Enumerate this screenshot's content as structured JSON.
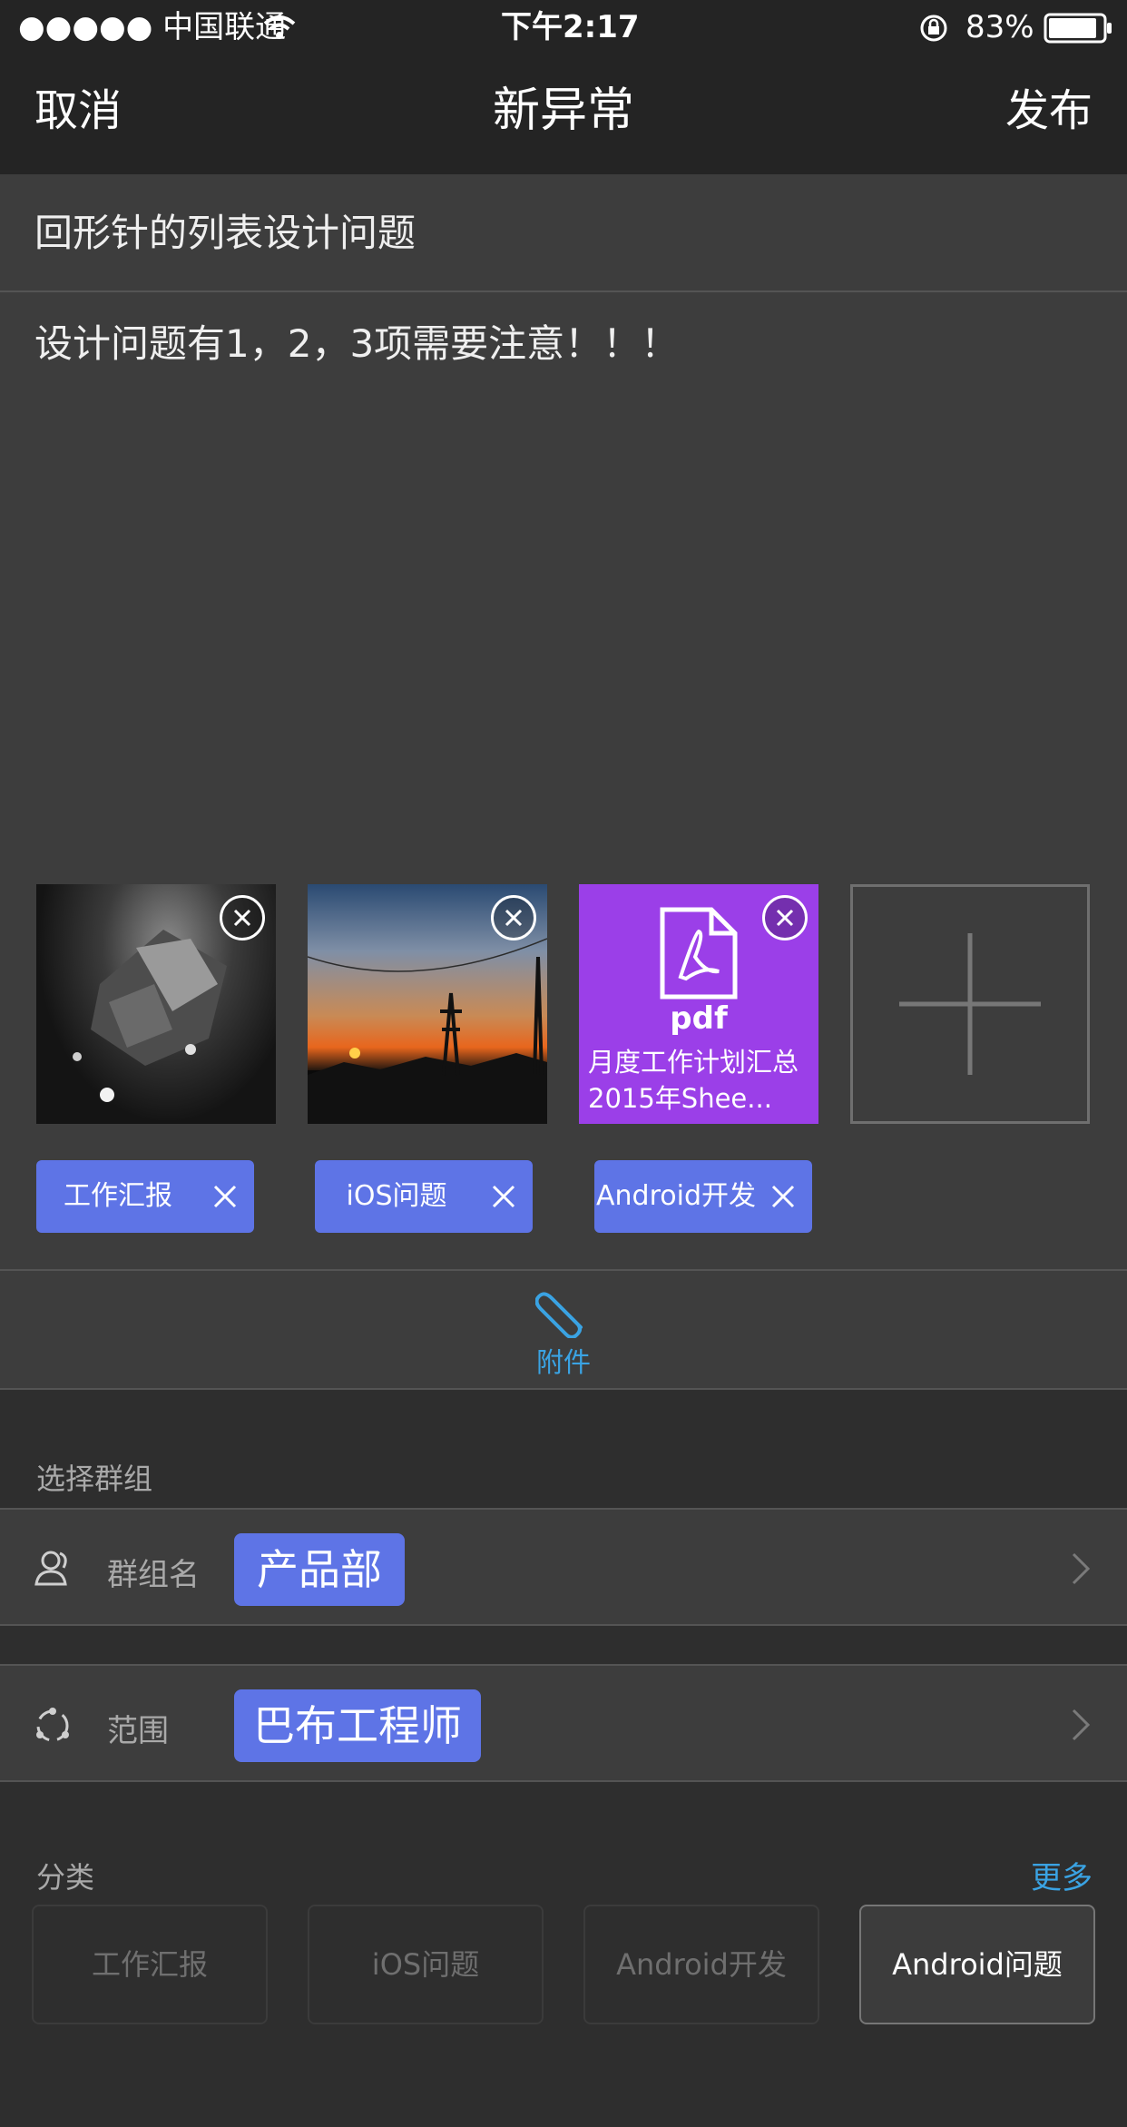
{
  "status_bar": {
    "carrier": "●●●●● 中国联通",
    "time": "下午2:17",
    "battery": "83%"
  },
  "nav": {
    "cancel": "取消",
    "title": "新异常",
    "publish": "发布"
  },
  "post": {
    "title": "回形针的列表设计问题",
    "body": "设计问题有1，2，3项需要注意！！！"
  },
  "attachments": [
    {
      "kind": "image",
      "icon": "photo"
    },
    {
      "kind": "image",
      "icon": "photo"
    },
    {
      "kind": "pdf",
      "type_label": "pdf",
      "filename": "月度工作计划汇总2015年Shee..."
    }
  ],
  "tags": [
    {
      "label": "工作汇报"
    },
    {
      "label": "iOS问题"
    },
    {
      "label": "Android开发"
    }
  ],
  "attach_button": {
    "label": "附件",
    "icon": "paperclip-icon",
    "color": "#3aa3e3"
  },
  "group_section": {
    "heading": "选择群组",
    "group": {
      "label": "群组名",
      "value": "产品部"
    },
    "scope": {
      "label": "范围",
      "value": "巴布工程师"
    }
  },
  "category_section": {
    "heading": "分类",
    "more": "更多",
    "options": [
      "工作汇报",
      "iOS问题",
      "Android开发",
      "Android问题"
    ],
    "selected": "Android问题"
  },
  "colors": {
    "accent": "#5e74e6",
    "link": "#3aa3e3",
    "pdf": "#9b3fe8"
  }
}
